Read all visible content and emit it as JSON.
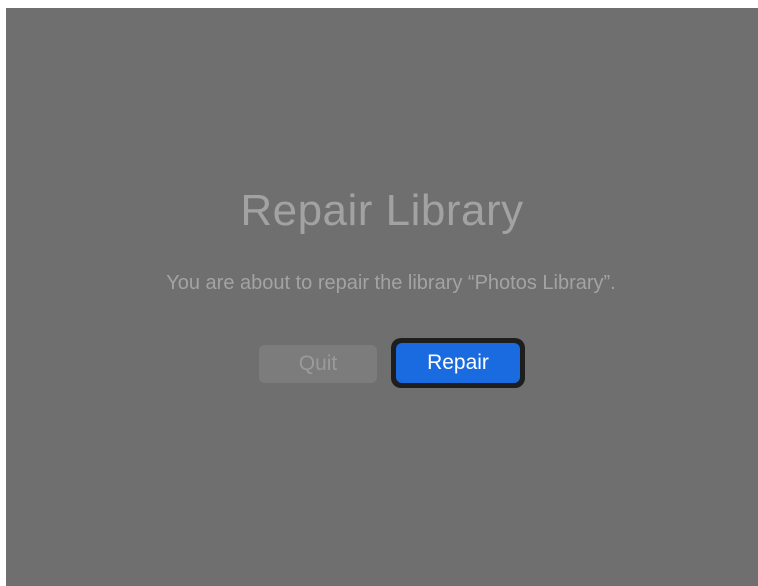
{
  "dialog": {
    "title": "Repair Library",
    "message": "You are about to repair the library “Photos Library”.",
    "buttons": {
      "quit_label": "Quit",
      "repair_label": "Repair"
    }
  },
  "colors": {
    "background": "#6f6f6f",
    "primary_button": "#1a6be0",
    "secondary_button": "#7c7c7c",
    "text_muted": "#a2a2a2"
  }
}
